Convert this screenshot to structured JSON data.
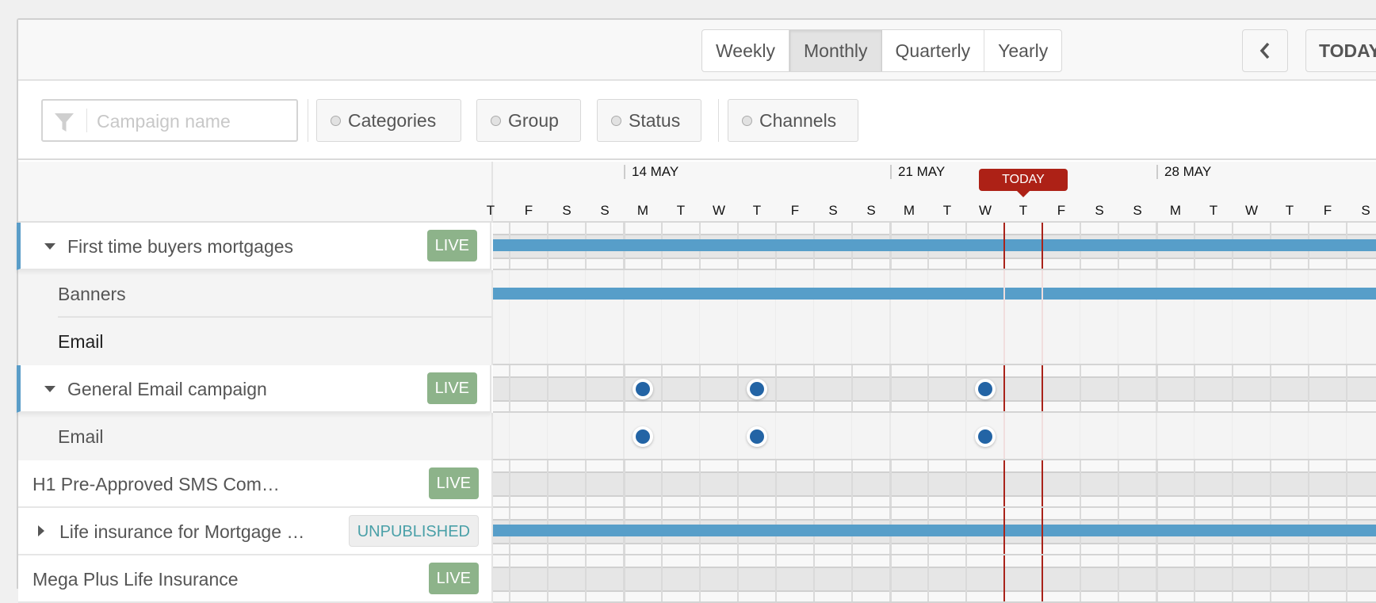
{
  "toolbar": {
    "views": [
      {
        "label": "Weekly",
        "active": false
      },
      {
        "label": "Monthly",
        "active": true
      },
      {
        "label": "Quarterly",
        "active": false
      },
      {
        "label": "Yearly",
        "active": false
      }
    ],
    "prev_icon": "chevron-left-icon",
    "today_label": "TODAY"
  },
  "filters": {
    "search_placeholder": "Campaign name",
    "search_value": "",
    "search_icon": "filter-funnel-icon",
    "buttons": [
      "Categories",
      "Group",
      "Status",
      "Channels"
    ]
  },
  "timeline": {
    "weeks": [
      "14 MAY",
      "21 MAY",
      "28 MAY"
    ],
    "days": [
      "T",
      "F",
      "S",
      "S",
      "M",
      "T",
      "W",
      "T",
      "F",
      "S",
      "S",
      "M",
      "T",
      "W",
      "T",
      "F",
      "S",
      "S",
      "M",
      "T",
      "W",
      "T",
      "F",
      "S"
    ],
    "today_label": "TODAY",
    "today_day_index": 14,
    "colors": {
      "today": "#ad2116",
      "bar": "#579ec9",
      "dot": "#2364a5",
      "live": "#8db38a",
      "unpublished": "#4aa0a8",
      "accent": "#5a9dc8"
    }
  },
  "rows": [
    {
      "type": "parent",
      "title": "First time buyers mortgages",
      "status": "LIVE",
      "expander": "expanded",
      "accent": true,
      "bar": true,
      "dots": []
    },
    {
      "type": "child",
      "title": "Banners",
      "bar": true,
      "dots": []
    },
    {
      "type": "child",
      "title": "Email",
      "bar": false,
      "dots": []
    },
    {
      "type": "parent",
      "title": "General Email campaign",
      "status": "LIVE",
      "expander": "expanded",
      "accent": true,
      "bar": false,
      "dots": [
        4,
        7,
        13
      ]
    },
    {
      "type": "child",
      "title": "Email",
      "bar": false,
      "dots": [
        4,
        7,
        13
      ]
    },
    {
      "type": "parent",
      "title": "H1 Pre-Approved SMS Com…",
      "status": "LIVE",
      "expander": "none",
      "accent": false,
      "bar": false,
      "dots": []
    },
    {
      "type": "parent",
      "title": "Life insurance for Mortgage …",
      "status": "UNPUBLISHED",
      "expander": "collapsed",
      "accent": false,
      "bar": true,
      "dots": []
    },
    {
      "type": "parent",
      "title": "Mega Plus Life Insurance",
      "status": "LIVE",
      "expander": "none",
      "accent": false,
      "bar": false,
      "dots": []
    }
  ]
}
